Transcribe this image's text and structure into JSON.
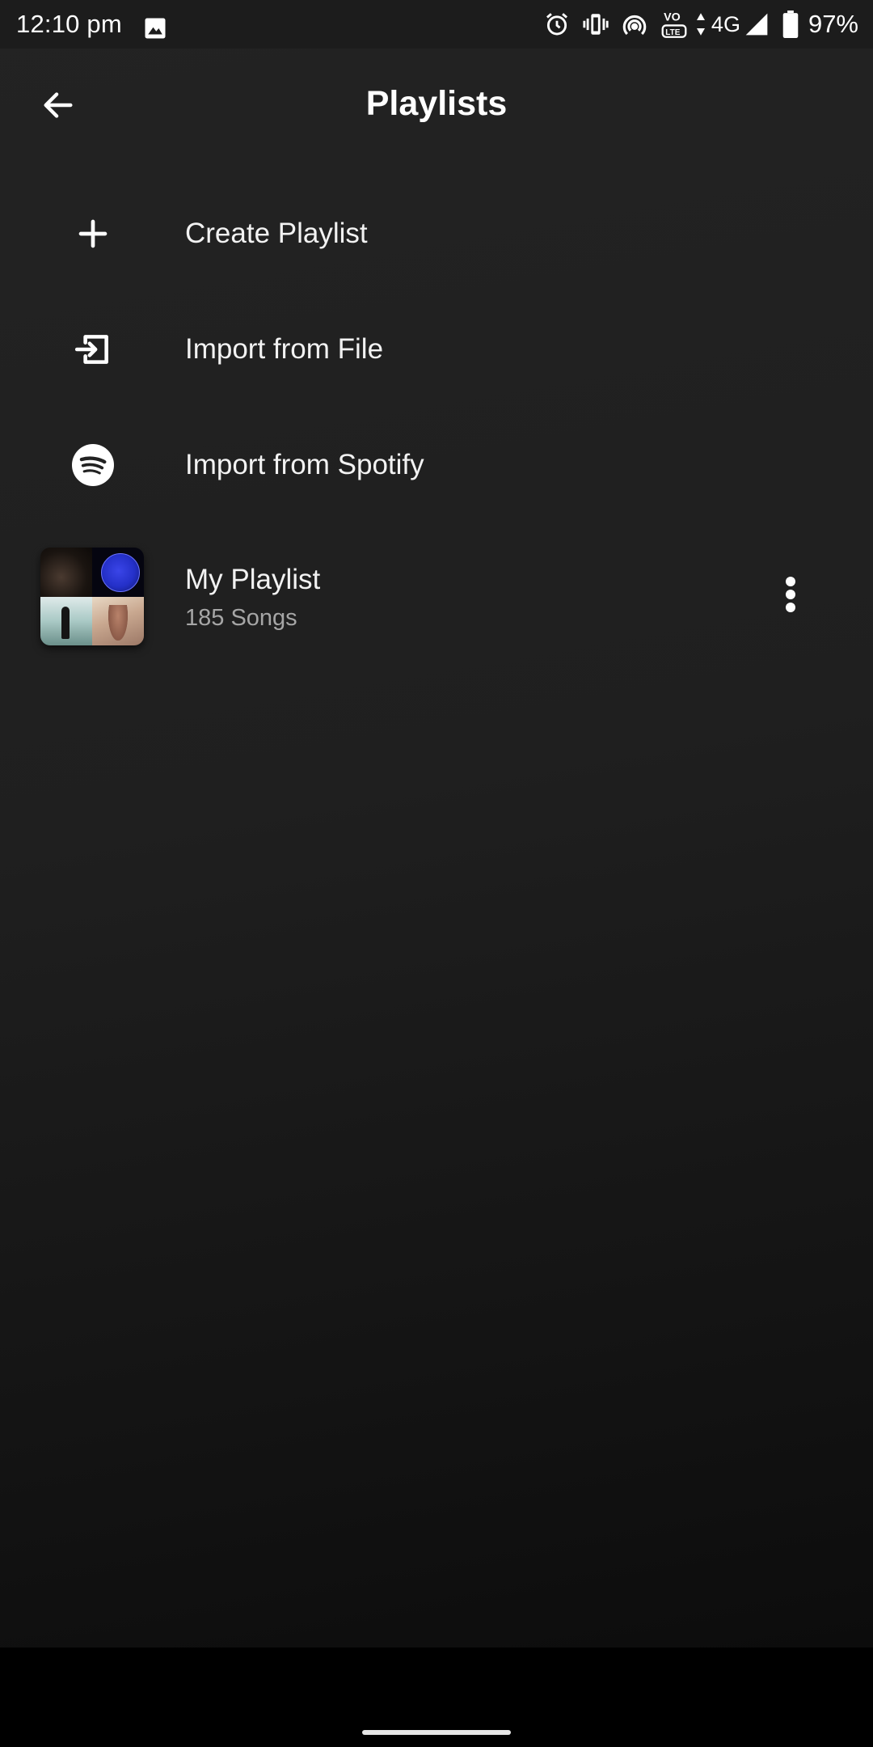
{
  "status_bar": {
    "time": "12:10 pm",
    "network": "4G",
    "battery": "97%",
    "icons": [
      "image-icon",
      "alarm-icon",
      "vibrate-icon",
      "hotspot-icon",
      "volte-icon",
      "data-arrows-icon",
      "signal-icon",
      "battery-icon"
    ]
  },
  "header": {
    "title": "Playlists",
    "back_icon": "arrow-left-icon"
  },
  "actions": [
    {
      "label": "Create Playlist",
      "icon": "plus-icon"
    },
    {
      "label": "Import from File",
      "icon": "import-icon"
    },
    {
      "label": "Import from Spotify",
      "icon": "spotify-icon"
    }
  ],
  "playlists": [
    {
      "name": "My Playlist",
      "count": "185 Songs",
      "menu_icon": "more-vert-icon"
    }
  ],
  "colors": {
    "background": "#1f1f1f",
    "text_primary": "#f2f2f2",
    "text_secondary": "#a6a6a6",
    "status_bar": "#1c1c1c"
  }
}
